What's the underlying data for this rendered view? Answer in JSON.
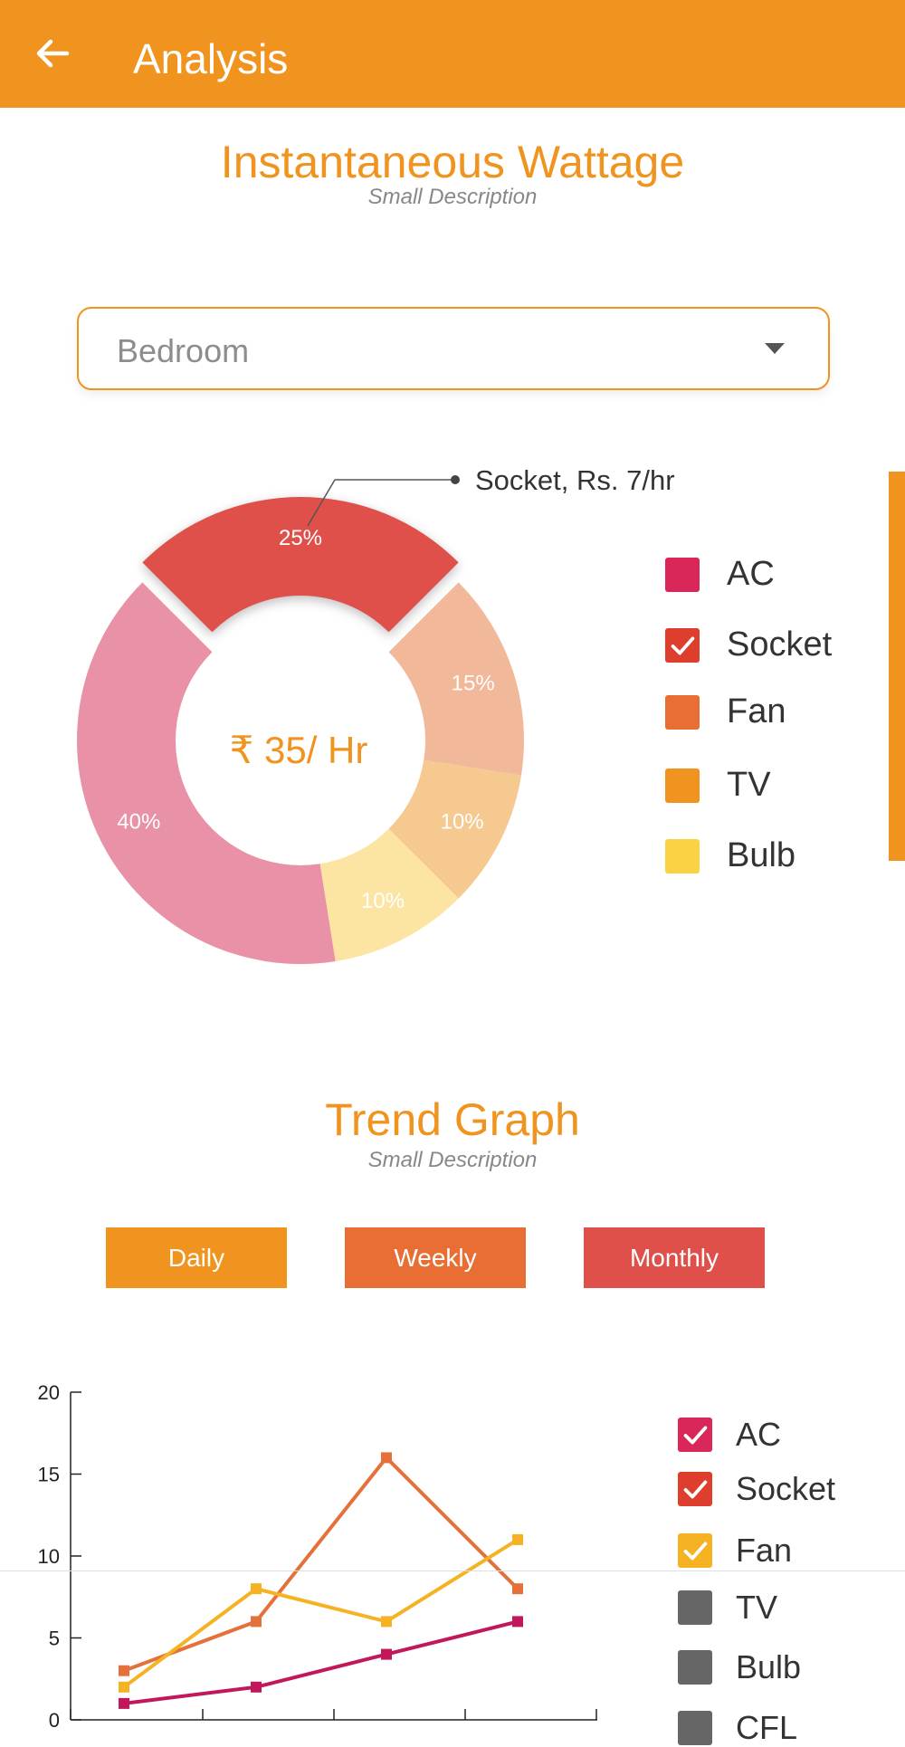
{
  "appbar": {
    "title": "Analysis",
    "back_icon": "arrow-left-icon",
    "color": "#F0941F"
  },
  "wattage": {
    "title": "Instantaneous Wattage",
    "description": "Small Description",
    "room_select": {
      "value": "Bedroom"
    },
    "center_label": "₹ 35/ Hr",
    "callout": "Socket, Rs. 7/hr",
    "legend": [
      {
        "label": "AC",
        "color": "#D9275A",
        "checked": false
      },
      {
        "label": "Socket",
        "color": "#DE3E2E",
        "checked": true
      },
      {
        "label": "Fan",
        "color": "#E86E34",
        "checked": false
      },
      {
        "label": "TV",
        "color": "#F0941F",
        "checked": false
      },
      {
        "label": "Bulb",
        "color": "#F9D342",
        "checked": false
      }
    ]
  },
  "chart_data": [
    {
      "type": "pie",
      "donut": true,
      "slices": [
        {
          "label": "25%",
          "value": 25,
          "color": "#E0504A"
        },
        {
          "label": "15%",
          "value": 15,
          "color": "#F2B89A"
        },
        {
          "label": "10%",
          "value": 10,
          "color": "#F6C991"
        },
        {
          "label": "10%",
          "value": 10,
          "color": "#FCE5A3"
        },
        {
          "label": "40%",
          "value": 40,
          "color": "#E891A7"
        }
      ]
    },
    {
      "type": "line",
      "x": [
        1,
        2,
        3,
        4
      ],
      "ylim": [
        0,
        20
      ],
      "yticks": [
        "0",
        "5",
        "10",
        "15",
        "20"
      ],
      "series": [
        {
          "name": "Socket",
          "values": [
            3,
            6,
            16,
            8
          ],
          "color": "#E5713A"
        },
        {
          "name": "Fan",
          "values": [
            2,
            8,
            6,
            11
          ],
          "color": "#F5B323"
        },
        {
          "name": "AC",
          "values": [
            1,
            2,
            4,
            6
          ],
          "color": "#C2185B"
        }
      ]
    }
  ],
  "trend": {
    "title": "Trend Graph",
    "description": "Small Description",
    "buttons": [
      {
        "label": "Daily",
        "color": "#F0941F"
      },
      {
        "label": "Weekly",
        "color": "#E86E34"
      },
      {
        "label": "Monthly",
        "color": "#E0504A"
      }
    ],
    "legend": [
      {
        "label": "AC",
        "color": "#D9275A",
        "checked": true
      },
      {
        "label": "Socket",
        "color": "#DE3E2E",
        "checked": true
      },
      {
        "label": "Fan",
        "color": "#F5B323",
        "checked": true
      },
      {
        "label": "TV",
        "color": "#666666",
        "checked": false
      },
      {
        "label": "Bulb",
        "color": "#666666",
        "checked": false
      },
      {
        "label": "CFL",
        "color": "#666666",
        "checked": false
      }
    ]
  }
}
